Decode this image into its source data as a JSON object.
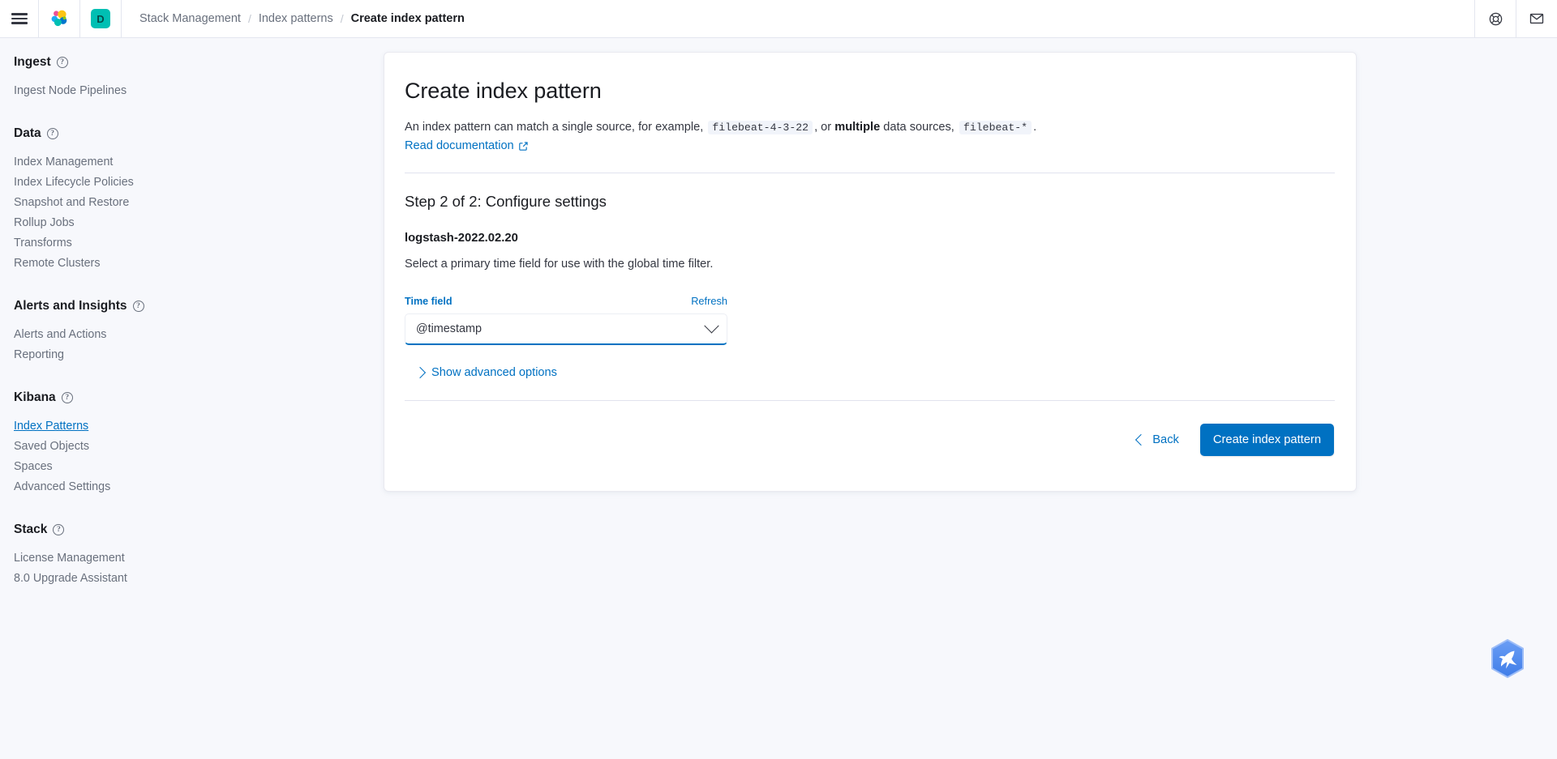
{
  "header": {
    "menu_icon": "hamburger-menu-icon",
    "logo_icon": "elastic-logo-icon",
    "space_avatar_label": "D",
    "breadcrumb": [
      {
        "label": "Stack Management",
        "current": false
      },
      {
        "label": "Index patterns",
        "current": false
      },
      {
        "label": "Create index pattern",
        "current": true
      }
    ],
    "separator": "/",
    "right_icons": [
      {
        "name": "help-lifebuoy-icon"
      },
      {
        "name": "mail-envelope-icon"
      }
    ]
  },
  "sidebar": {
    "groups": [
      {
        "title": "Ingest",
        "help_icon": "question-circle-icon",
        "items": [
          {
            "label": "Ingest Node Pipelines",
            "active": false
          }
        ]
      },
      {
        "title": "Data",
        "help_icon": "question-circle-icon",
        "items": [
          {
            "label": "Index Management",
            "active": false
          },
          {
            "label": "Index Lifecycle Policies",
            "active": false
          },
          {
            "label": "Snapshot and Restore",
            "active": false
          },
          {
            "label": "Rollup Jobs",
            "active": false
          },
          {
            "label": "Transforms",
            "active": false
          },
          {
            "label": "Remote Clusters",
            "active": false
          }
        ]
      },
      {
        "title": "Alerts and Insights",
        "help_icon": "question-circle-icon",
        "items": [
          {
            "label": "Alerts and Actions",
            "active": false
          },
          {
            "label": "Reporting",
            "active": false
          }
        ]
      },
      {
        "title": "Kibana",
        "help_icon": "question-circle-icon",
        "items": [
          {
            "label": "Index Patterns",
            "active": true
          },
          {
            "label": "Saved Objects",
            "active": false
          },
          {
            "label": "Spaces",
            "active": false
          },
          {
            "label": "Advanced Settings",
            "active": false
          }
        ]
      },
      {
        "title": "Stack",
        "help_icon": "question-circle-icon",
        "items": [
          {
            "label": "License Management",
            "active": false
          },
          {
            "label": "8.0 Upgrade Assistant",
            "active": false
          }
        ]
      }
    ]
  },
  "main": {
    "title": "Create index pattern",
    "description": {
      "part1": "An index pattern can match a single source, for example,",
      "code1": "filebeat-4-3-22",
      "part2": ", or",
      "bold1": "multiple",
      "part3": "data sources,",
      "code2": "filebeat-*",
      "part4": "."
    },
    "doc_link": {
      "label": "Read documentation",
      "icon": "external-link-icon"
    },
    "step_title": "Step 2 of 2: Configure settings",
    "pattern_name": "logstash-2022.02.20",
    "pattern_help": "Select a primary time field for use with the global time filter.",
    "time_field": {
      "label": "Time field",
      "refresh_label": "Refresh",
      "selected_value": "@timestamp",
      "chevron_icon": "chevron-down-icon"
    },
    "advanced": {
      "label": "Show advanced options",
      "chevron_icon": "chevron-right-icon"
    },
    "actions": {
      "back_label": "Back",
      "back_icon": "chevron-left-icon",
      "create_label": "Create index pattern"
    }
  },
  "overlay": {
    "extension_badge": "hummingbird-hexagon-icon"
  },
  "colors": {
    "accent_blue": "#0071c2",
    "teal_avatar": "#00bfb3",
    "text_dark": "#1a1c21",
    "text_muted": "#69707d",
    "page_bg": "#f7f8fc",
    "panel_bg": "#ffffff"
  }
}
